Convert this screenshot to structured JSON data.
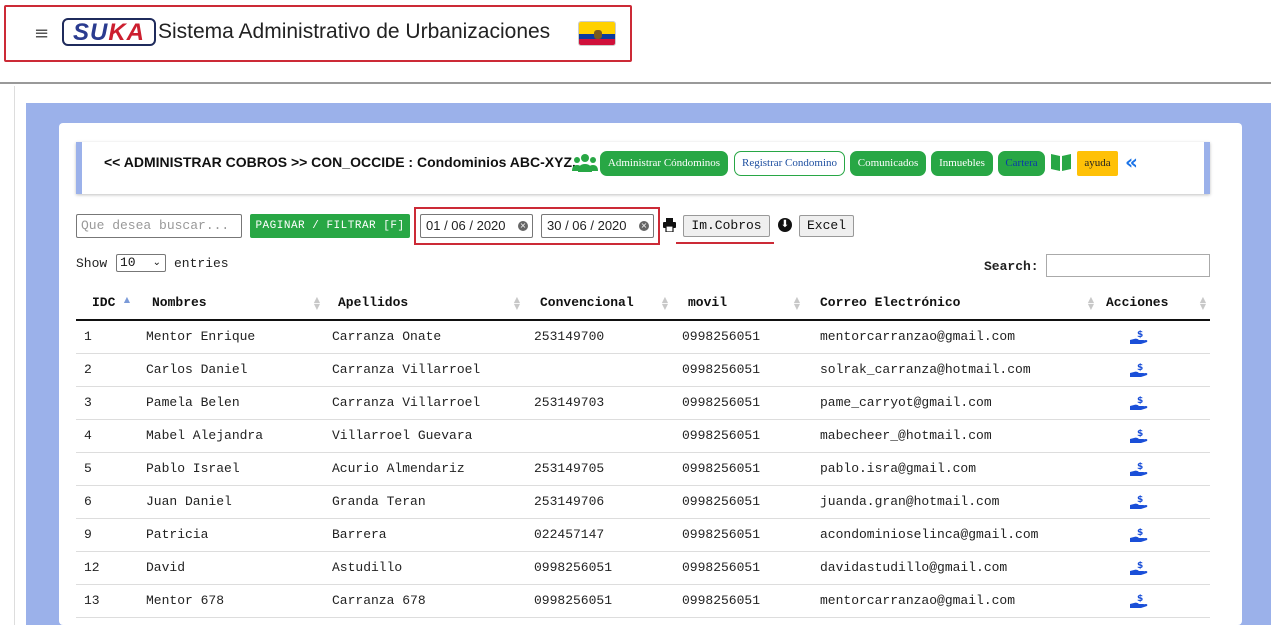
{
  "header": {
    "menu_icon": "hamburger-icon",
    "logo_text_a": "SU",
    "logo_text_b": "KA",
    "title": "Sistema Administrativo de Urbanizaciones",
    "flag": "ecuador-flag"
  },
  "panel": {
    "breadcrumb": "<< ADMINISTRAR COBROS >> CON_OCCIDE : Condominios ABC-XYZ.",
    "buttons": {
      "administrar": "Administrar Cóndominos",
      "registrar": "Registrar Condomino",
      "comunicados": "Comunicados",
      "inmuebles": "Inmuebles",
      "cartera": "Cartera",
      "ayuda": "ayuda"
    },
    "colors": {
      "green": "#28a745",
      "yellow": "#ffc107",
      "frame_blue": "#9bb1ea",
      "highlight_red": "#cc2a36"
    }
  },
  "toolbar": {
    "search_placeholder": "Que desea buscar...",
    "filter_button": "PAGINAR / FILTRAR [F]",
    "date_from": "01 / 06 / 2020",
    "date_to": "30 / 06 / 2020",
    "print_cobros": "Im.Cobros",
    "excel": "Excel"
  },
  "datatable": {
    "show_label": "Show",
    "page_length": "10",
    "entries_label": "entries",
    "search_label": "Search:",
    "columns": [
      "IDC",
      "Nombres",
      "Apellidos",
      "Convencional",
      "movil",
      "Correo Electrónico",
      "Acciones"
    ],
    "sorted_column": "IDC",
    "rows": [
      {
        "idc": "1",
        "nombres": "Mentor Enrique",
        "apellidos": "Carranza Onate",
        "convencional": "253149700",
        "movil": "0998256051",
        "correo": "mentorcarranzao@gmail.com"
      },
      {
        "idc": "2",
        "nombres": "Carlos Daniel",
        "apellidos": "Carranza Villarroel",
        "convencional": "",
        "movil": "0998256051",
        "correo": "solrak_carranza@hotmail.com"
      },
      {
        "idc": "3",
        "nombres": "Pamela Belen",
        "apellidos": "Carranza Villarroel",
        "convencional": "253149703",
        "movil": "0998256051",
        "correo": "pame_carryot@gmail.com"
      },
      {
        "idc": "4",
        "nombres": "Mabel Alejandra",
        "apellidos": "Villarroel Guevara",
        "convencional": "",
        "movil": "0998256051",
        "correo": "mabecheer_@hotmail.com"
      },
      {
        "idc": "5",
        "nombres": "Pablo Israel",
        "apellidos": "Acurio Almendariz",
        "convencional": "253149705",
        "movil": "0998256051",
        "correo": "pablo.isra@gmail.com"
      },
      {
        "idc": "6",
        "nombres": "Juan Daniel",
        "apellidos": "Granda Teran",
        "convencional": "253149706",
        "movil": "0998256051",
        "correo": "juanda.gran@hotmail.com"
      },
      {
        "idc": "9",
        "nombres": "Patricia",
        "apellidos": "Barrera",
        "convencional": "022457147",
        "movil": "0998256051",
        "correo": "acondominioselinca@gmail.com"
      },
      {
        "idc": "12",
        "nombres": "David",
        "apellidos": "Astudillo",
        "convencional": "0998256051",
        "movil": "0998256051",
        "correo": "davidastudillo@gmail.com"
      },
      {
        "idc": "13",
        "nombres": "Mentor 678",
        "apellidos": "Carranza 678",
        "convencional": "0998256051",
        "movil": "0998256051",
        "correo": "mentorcarranzao@gmail.com"
      }
    ],
    "action_icon": "payment-hand-icon"
  }
}
